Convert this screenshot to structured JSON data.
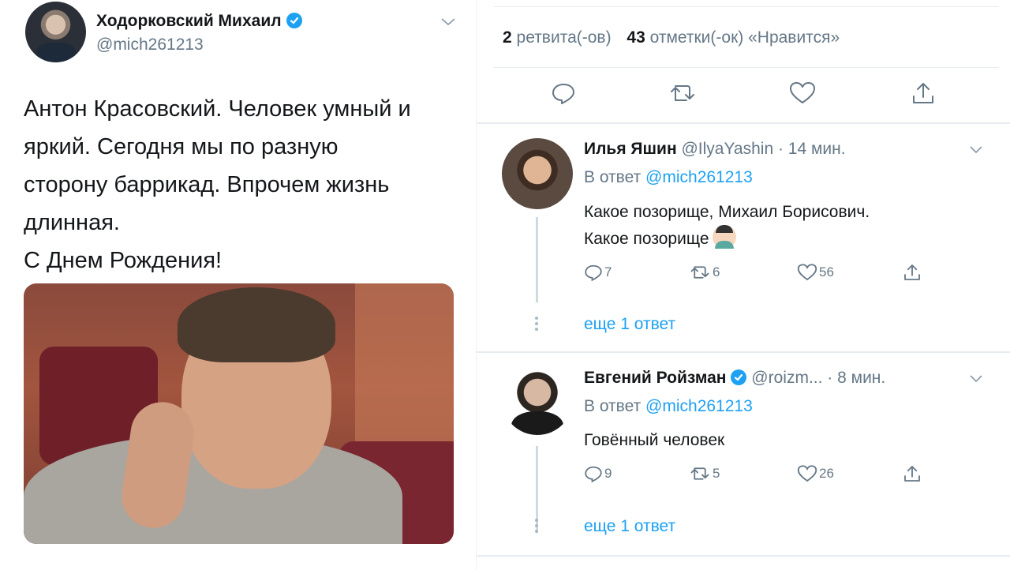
{
  "tweet": {
    "author_name": "Ходорковский Михаил",
    "author_handle": "@mich261213",
    "text_lines": [
      "Антон Красовский. Человек умный и",
      "яркий. Сегодня мы по разную",
      "сторону баррикад. Впрочем жизнь",
      "длинная.",
      "С Днем Рождения!"
    ],
    "retweets_count": "2",
    "retweets_label": "ретвита(-ов)",
    "likes_count": "43",
    "likes_label": "отметки(-ок) «Нравится»"
  },
  "replies": [
    {
      "name": "Илья Яшин",
      "handle": "@IlyaYashin",
      "time": "· 14 мин.",
      "reply_to_label": "В ответ",
      "reply_to_handle": "@mich261213",
      "text_line1": "Какое позорище, Михаил Борисович.",
      "text_line2": "Какое позорище",
      "replies": "7",
      "retweets": "6",
      "likes": "56",
      "more": "еще 1 ответ"
    },
    {
      "name": "Евгений Ройзман",
      "handle": "@roizm...",
      "time": "· 8 мин.",
      "reply_to_label": "В ответ",
      "reply_to_handle": "@mich261213",
      "text_line1": "Говённый человек",
      "replies": "9",
      "retweets": "5",
      "likes": "26",
      "more": "еще 1 ответ"
    }
  ],
  "colors": {
    "accent": "#1da1f2",
    "muted": "#657786",
    "text": "#14171a"
  }
}
